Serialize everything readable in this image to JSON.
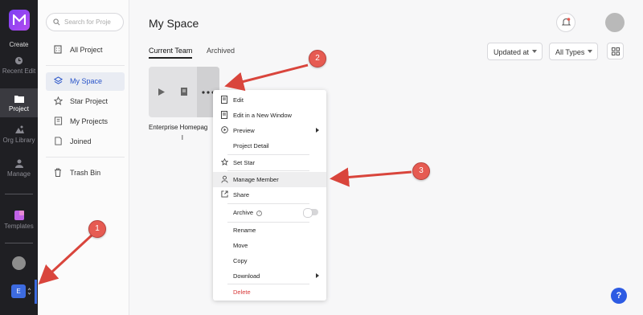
{
  "rail": {
    "create_label": "Create",
    "items": [
      {
        "label": "Recent Edit"
      },
      {
        "label": "Project"
      },
      {
        "label": "Org Library"
      },
      {
        "label": "Manage"
      },
      {
        "label": "Templates"
      }
    ],
    "team_initial": "E",
    "accent": "#7b3ff2"
  },
  "sidebar": {
    "search_placeholder": "Search for Proje",
    "items": [
      {
        "label": "All Project"
      },
      {
        "label": "My Space"
      },
      {
        "label": "Star Project"
      },
      {
        "label": "My Projects"
      },
      {
        "label": "Joined"
      },
      {
        "label": "Trash Bin"
      }
    ]
  },
  "main": {
    "title": "My Space",
    "tabs": [
      {
        "label": "Current Team"
      },
      {
        "label": "Archived"
      }
    ],
    "sort_label": "Updated at",
    "type_label": "All Types",
    "card": {
      "name_line1": "Enterprise Homepag",
      "name_line2": "l"
    }
  },
  "menu": {
    "items": [
      {
        "label": "Edit"
      },
      {
        "label": "Edit in a New Window"
      },
      {
        "label": "Preview"
      },
      {
        "label": "Project Detail"
      },
      {
        "label": "Set Star"
      },
      {
        "label": "Manage Member"
      },
      {
        "label": "Share"
      },
      {
        "label": "Archive"
      },
      {
        "label": "Rename"
      },
      {
        "label": "Move"
      },
      {
        "label": "Copy"
      },
      {
        "label": "Download"
      },
      {
        "label": "Delete"
      }
    ]
  },
  "annotations": [
    "1",
    "2",
    "3"
  ],
  "help_label": "?",
  "colors": {
    "primary": "#2954c9",
    "danger": "#d83b3b",
    "annotation": "#e65b52"
  }
}
